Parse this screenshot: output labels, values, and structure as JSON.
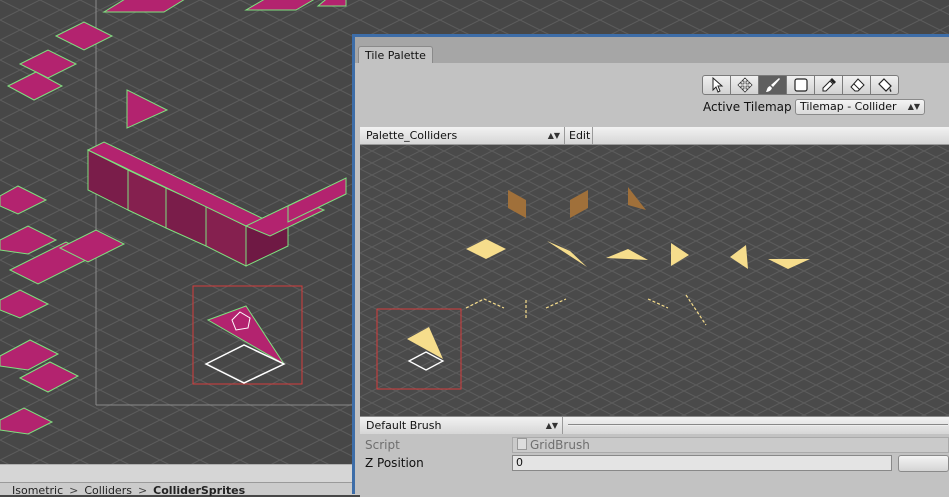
{
  "breadcrumb": [
    "Isometric",
    "Colliders",
    "ColliderSprites"
  ],
  "palette_window": {
    "tab_title": "Tile Palette",
    "tools": [
      {
        "icon": "select-arrow-icon",
        "active": false
      },
      {
        "icon": "move-icon",
        "active": false
      },
      {
        "icon": "paintbrush-icon",
        "active": true
      },
      {
        "icon": "box-fill-icon",
        "active": false
      },
      {
        "icon": "picker-icon",
        "active": false
      },
      {
        "icon": "eraser-icon",
        "active": false
      },
      {
        "icon": "fill-bucket-icon",
        "active": false
      }
    ],
    "active_tilemap_label": "Active Tilemap",
    "active_tilemap_value": "Tilemap - Collider",
    "palette_name": "Palette_Colliders",
    "edit_label": "Edit",
    "brush_name": "Default Brush",
    "script_label": "Script",
    "script_value": "GridBrush",
    "z_position_label": "Z Position",
    "z_position_value": "0"
  },
  "colors": {
    "window_border": "#3d6da8",
    "panel_bg": "#c2c2c2",
    "scene_bg": "#474747",
    "magenta_tile": "#b3236f",
    "collider_outline": "#7fe07f",
    "palette_tile_yellow": "#f6dd8c",
    "palette_tile_brown": "#a0703a",
    "selection_red": "#d43c3c"
  }
}
